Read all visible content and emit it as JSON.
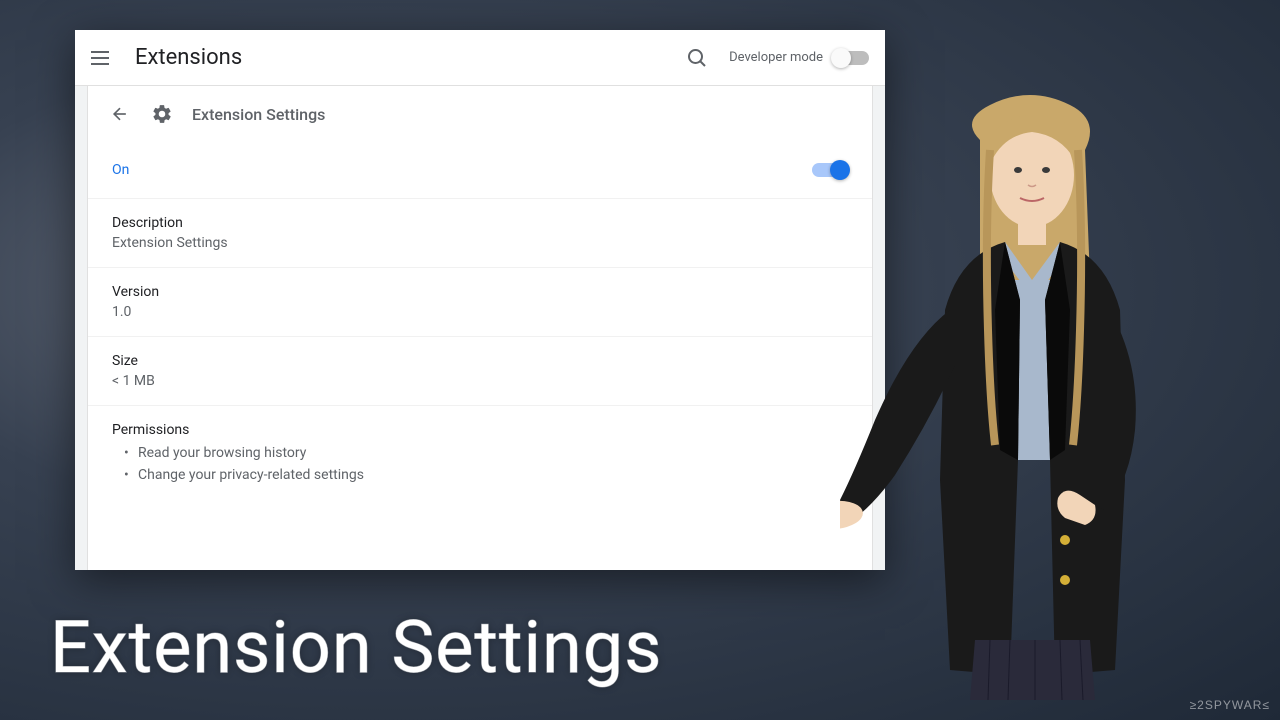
{
  "topbar": {
    "title": "Extensions",
    "devmode_label": "Developer mode"
  },
  "detail": {
    "title": "Extension Settings",
    "on_label": "On",
    "description_label": "Description",
    "description_value": "Extension Settings",
    "version_label": "Version",
    "version_value": "1.0",
    "size_label": "Size",
    "size_value": "< 1 MB",
    "permissions_label": "Permissions",
    "permissions": [
      "Read your browsing history",
      "Change your privacy-related settings"
    ]
  },
  "overlay": {
    "big_title": "Extension Settings",
    "watermark": "≥2SPYWAR≤"
  }
}
